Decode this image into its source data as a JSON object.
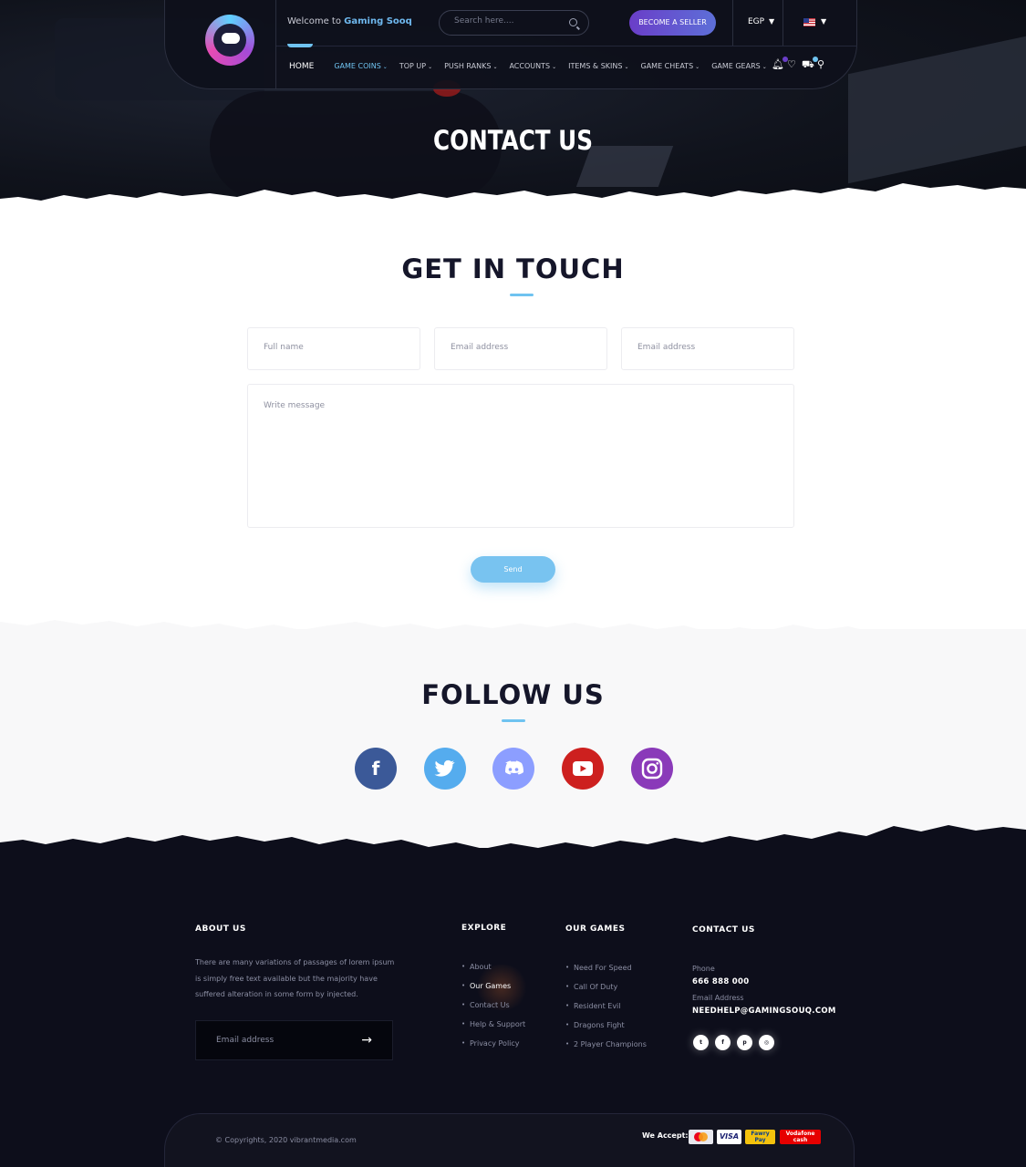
{
  "header": {
    "welcome_prefix": "Welcome to ",
    "welcome_brand": "Gaming Sooq",
    "search_placeholder": "Search here....",
    "become_seller": "BECOME A SELLER",
    "currency": "EGP",
    "currency_caret": "▼",
    "flag_caret": "▼",
    "menu": [
      {
        "label": "HOME",
        "chevron": ""
      },
      {
        "label": "GAME COINS",
        "chevron": "⌄"
      },
      {
        "label": "TOP UP",
        "chevron": "⌄"
      },
      {
        "label": "PUSH RANKS",
        "chevron": "⌄"
      },
      {
        "label": "ACCOUNTS",
        "chevron": "⌄"
      },
      {
        "label": "ITEMS & SKINS",
        "chevron": "⌄"
      },
      {
        "label": "GAME CHEATS",
        "chevron": "⌄"
      },
      {
        "label": "GAME GEARS",
        "chevron": "⌄"
      }
    ],
    "notification_count": "2",
    "cart_count": "0"
  },
  "hero": {
    "title": "CONTACT US"
  },
  "contact": {
    "title": "GET IN TOUCH",
    "full_name_placeholder": "Full name",
    "email_placeholder_1": "Email address",
    "email_placeholder_2": "Email address",
    "message_placeholder": "Write message",
    "send_label": "Send"
  },
  "follow": {
    "title": "FOLLOW US",
    "networks": [
      {
        "name": "facebook",
        "glyph": "f",
        "color": "#3b5998"
      },
      {
        "name": "twitter",
        "glyph": "t",
        "color": "#55acee"
      },
      {
        "name": "discord",
        "glyph": "d",
        "color": "#8c9eff"
      },
      {
        "name": "youtube",
        "glyph": "▶",
        "color": "#cd201f"
      },
      {
        "name": "instagram",
        "glyph": "◎",
        "color": "#8a3ab9"
      }
    ]
  },
  "footer": {
    "about_title": "ABOUT US",
    "about_text": "There are many variations of passages of lorem ipsum is simply free text available but the majority have suffered alteration in some form by injected.",
    "newsletter_placeholder": "Email address",
    "newsletter_arrow": "→",
    "explore_title": "EXPLORE",
    "explore_items": [
      "About",
      "Our Games",
      "Contact Us",
      "Help & Support",
      "Privacy Policy"
    ],
    "games_title": "OUR GAMES",
    "games_items": [
      "Need For Speed",
      "Call Of Duty",
      "Resident Evil",
      "Dragons Fight",
      "2 Player Champions"
    ],
    "contact_title": "CONTACT US",
    "phone_label": "Phone",
    "phone_value": "666 888 000",
    "email_label": "Email Address",
    "email_value": "NEEDHELP@GAMINGSOUQ.COM",
    "social_icons": [
      "twitter-icon",
      "facebook-icon",
      "pinterest-icon",
      "instagram-icon"
    ],
    "copyright": "© Copyrights, 2020 vibrantmedia.com",
    "we_accept": "We Accept:",
    "payments": [
      {
        "name": "mastercard",
        "label": "Master",
        "color": "#e8e8ee",
        "text": "#eb001b"
      },
      {
        "name": "visa",
        "label": "VISA",
        "color": "#ffffff",
        "text": "#1a1f71"
      },
      {
        "name": "fawry",
        "label": "Fawry Pay",
        "color": "#f4c20d",
        "text": "#0a3f8a"
      },
      {
        "name": "vodafone-cash",
        "label": "Vodafone cash",
        "color": "#e60000",
        "text": "#ffffff"
      }
    ]
  }
}
